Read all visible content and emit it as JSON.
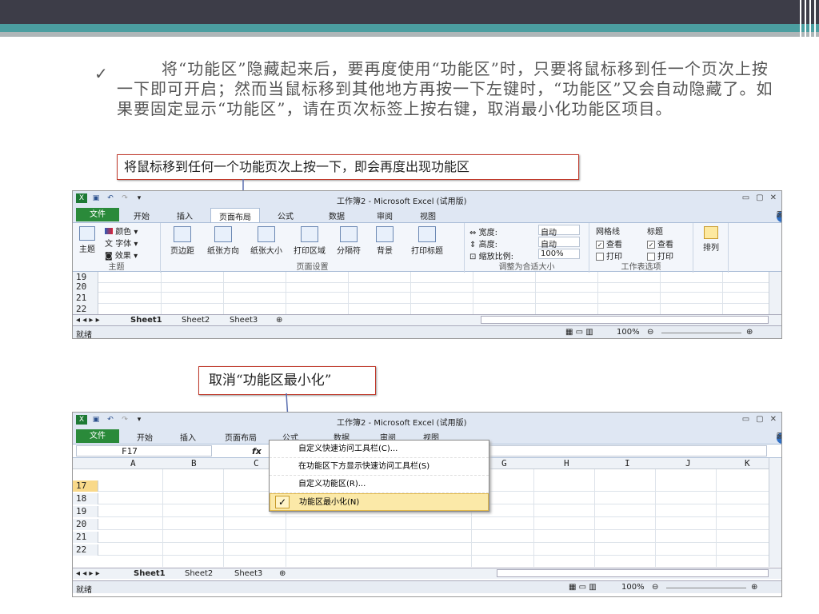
{
  "slide": {
    "bullet": "✓",
    "paragraph": "将“功能区”隐藏起来后，要再度使用“功能区”时，只要将鼠标移到任一个页次上按一下即可开启；然而当鼠标移到其他地方再按一下左键时，“功能区”又会自动隐藏了。如果要固定显示“功能区”，请在页次标签上按右键，取消最小化功能区项目。",
    "callout1": "将鼠标移到任何一个功能页次上按一下，即会再度出现功能区",
    "callout2": "取消“功能区最小化”"
  },
  "window1": {
    "title": "工作簿2 - Microsoft Excel (试用版)",
    "tabs": [
      "文件",
      "开始",
      "插入",
      "页面布局",
      "公式",
      "数据",
      "审阅",
      "视图"
    ],
    "active_tab": "页面布局",
    "groups": {
      "theme": {
        "label": "主题",
        "main": "主题",
        "colors": "颜色",
        "fonts": "字体",
        "effects": "效果"
      },
      "page_setup": {
        "label": "页面设置",
        "buttons": [
          "页边距",
          "纸张方向",
          "纸张大小",
          "打印区域",
          "分隔符",
          "背景",
          "打印标题"
        ]
      },
      "scale": {
        "label": "调整为合适大小",
        "width_label": "宽度:",
        "width_value": "自动",
        "height_label": "高度:",
        "height_value": "自动",
        "scale_label": "缩放比例:",
        "scale_value": "100%"
      },
      "sheet_options": {
        "label": "工作表选项",
        "gridlines": "网格线",
        "headings": "标题",
        "view": "查看",
        "print": "打印"
      },
      "arrange": {
        "label": "排列"
      }
    },
    "rows": [
      "19",
      "20",
      "21",
      "22"
    ],
    "sheets": [
      "Sheet1",
      "Sheet2",
      "Sheet3"
    ],
    "status": "就绪",
    "zoom": "100%"
  },
  "window2": {
    "title": "工作簿2 - Microsoft Excel (试用版)",
    "tabs": [
      "文件",
      "开始",
      "插入",
      "页面布局",
      "公式",
      "数据",
      "审阅",
      "视图"
    ],
    "name_box": "F17",
    "fx": "fx",
    "columns": [
      "A",
      "B",
      "C",
      "G",
      "H",
      "I",
      "J",
      "K"
    ],
    "rows": [
      "17",
      "18",
      "19",
      "20",
      "21",
      "22"
    ],
    "sheets": [
      "Sheet1",
      "Sheet2",
      "Sheet3"
    ],
    "status": "就绪",
    "zoom": "100%",
    "context_menu": [
      {
        "label": "自定义快速访问工具栏(C)...",
        "checked": false
      },
      {
        "label": "在功能区下方显示快速访问工具栏(S)",
        "checked": false
      },
      {
        "label": "自定义功能区(R)...",
        "checked": false
      },
      {
        "label": "功能区最小化(N)",
        "checked": true
      }
    ]
  },
  "colors": {
    "accent_teal": "#4b9ea0",
    "file_tab": "#2a8a3a",
    "callout_border": "#c0392b"
  }
}
